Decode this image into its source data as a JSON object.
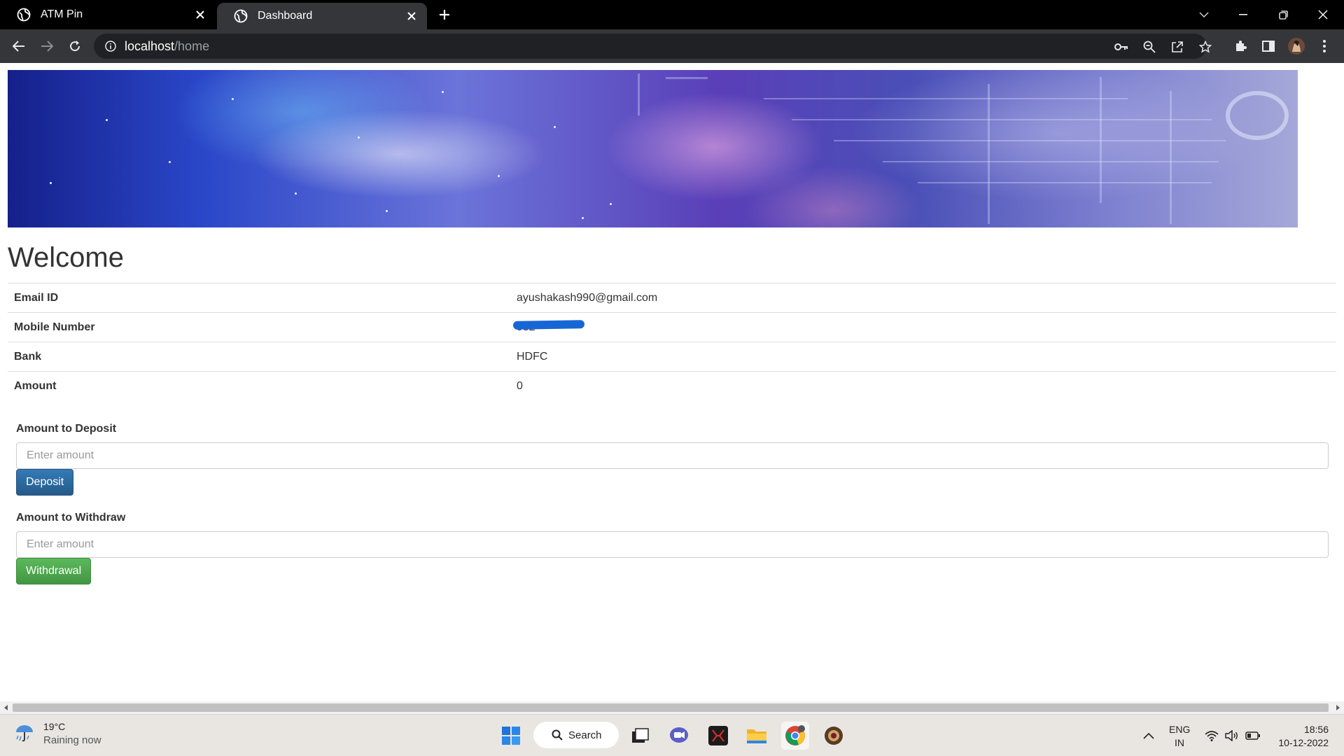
{
  "browser": {
    "tabs": [
      {
        "title": "ATM Pin",
        "active": false
      },
      {
        "title": "Dashboard",
        "active": true
      }
    ],
    "url_host": "localhost",
    "url_path": "/home"
  },
  "page": {
    "heading": "Welcome",
    "profile": [
      {
        "label": "Email ID",
        "value": "ayushakash990@gmail.com"
      },
      {
        "label": "Mobile Number",
        "value": "952"
      },
      {
        "label": "Bank",
        "value": "HDFC"
      },
      {
        "label": "Amount",
        "value": "0"
      }
    ],
    "deposit": {
      "label": "Amount to Deposit",
      "placeholder": "Enter amount",
      "button": "Deposit"
    },
    "withdraw": {
      "label": "Amount to Withdraw",
      "placeholder": "Enter amount",
      "button": "Withdrawal"
    }
  },
  "taskbar": {
    "weather_temp": "19°C",
    "weather_desc": "Raining now",
    "search_label": "Search",
    "lang_1": "ENG",
    "lang_2": "IN",
    "time": "18:56",
    "date": "10-12-2022"
  },
  "colors": {
    "deposit_button": "#337ab7",
    "withdraw_button": "#5cb85c",
    "tab_bar": "#000000",
    "toolbar": "#35363a"
  }
}
